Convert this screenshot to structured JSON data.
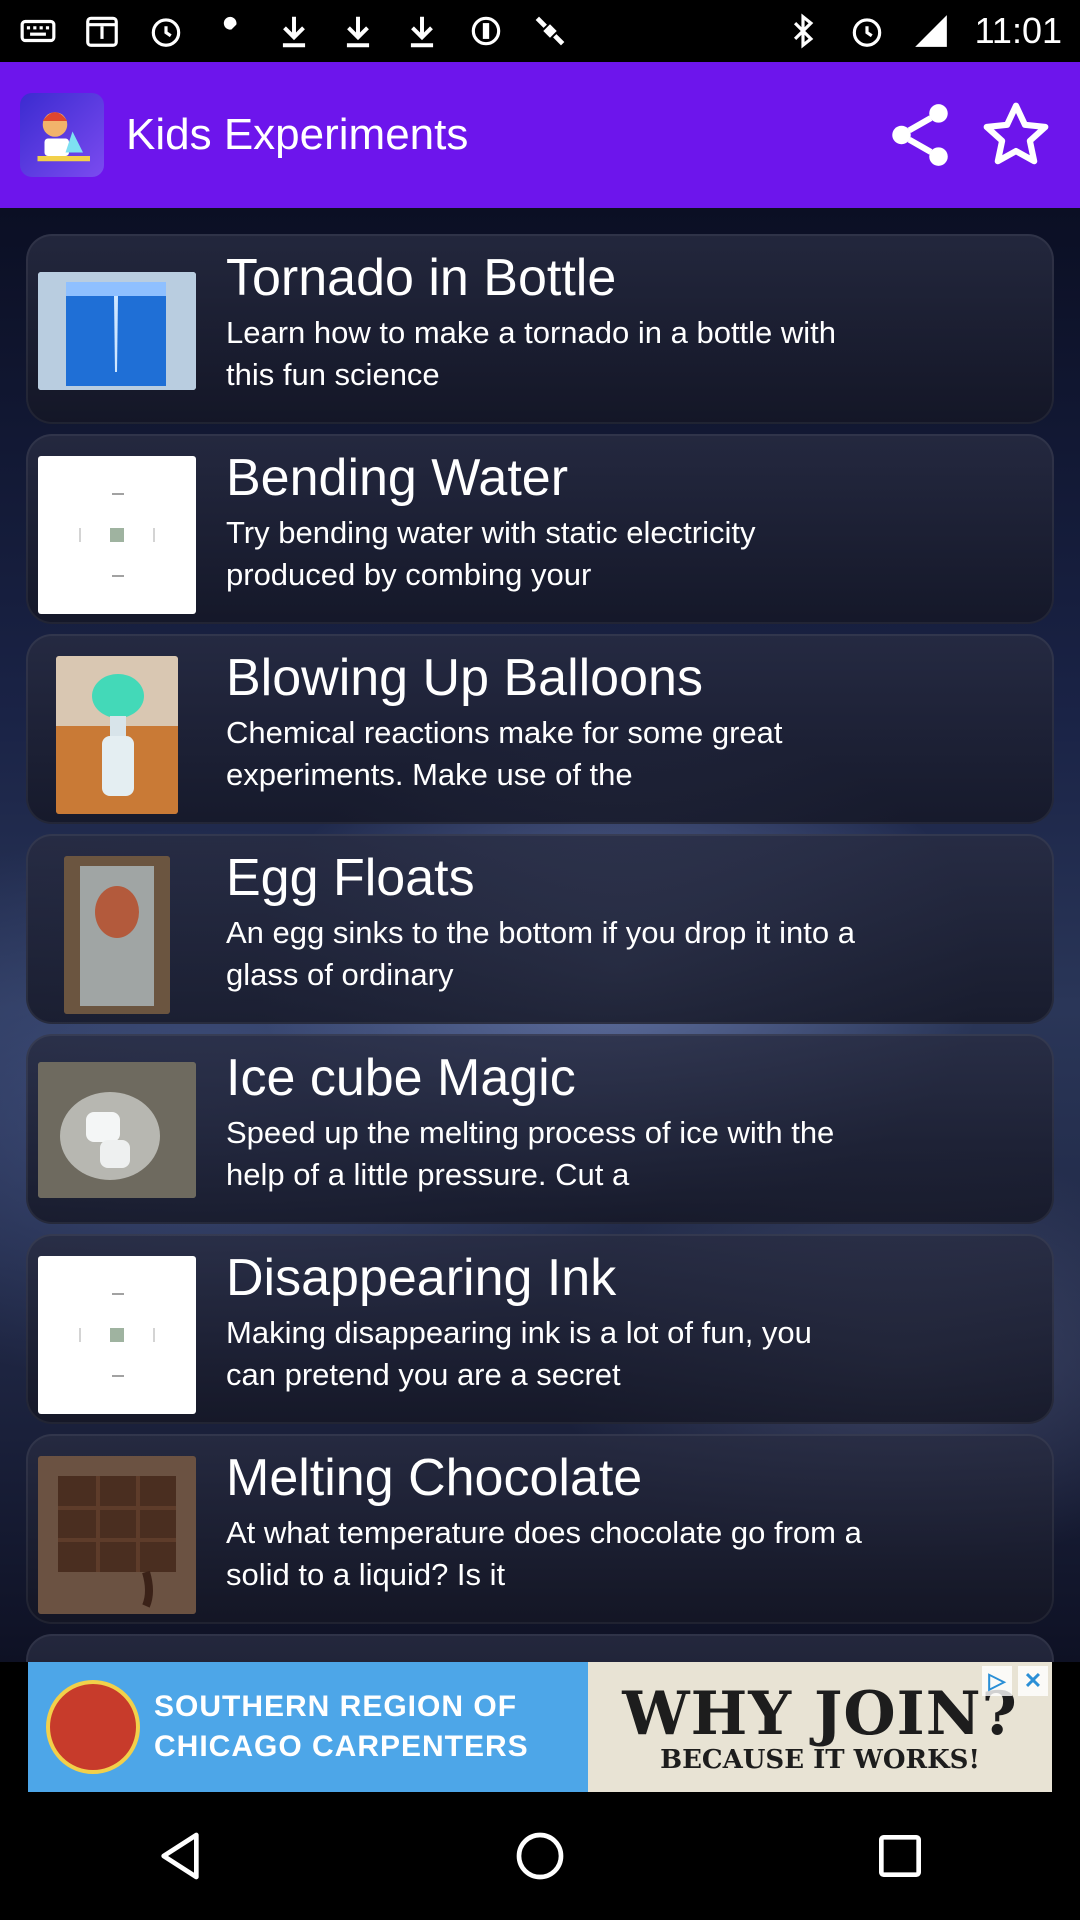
{
  "status_bar": {
    "time": "11:01",
    "left_icons": [
      "keyboard-icon",
      "calendar-icon",
      "alarm-icon",
      "wrench-icon",
      "download-icon",
      "download-icon",
      "download-icon",
      "gps-off-icon",
      "satellite-icon"
    ],
    "right_icons": [
      "bluetooth-icon",
      "alarm-icon",
      "signal-icon"
    ]
  },
  "app_bar": {
    "title": "Kids Experiments",
    "accent_color": "#6d15ec",
    "actions": [
      "share-icon",
      "star-icon"
    ]
  },
  "experiments": [
    {
      "title": "Tornado in Bottle",
      "description": "Learn how to make a tornado in a bottle with this fun science",
      "thumb": "tornado-bottle-photo"
    },
    {
      "title": "Bending Water",
      "description": "Try bending water with static electricity produced by combing your",
      "thumb": "broken-image-icon"
    },
    {
      "title": "Blowing Up Balloons",
      "description": "Chemical reactions make for some great experiments. Make use of the",
      "thumb": "balloon-bottle-photo"
    },
    {
      "title": "Egg Floats",
      "description": "An egg sinks to the bottom if you drop it into a glass of ordinary",
      "thumb": "egg-glass-photo"
    },
    {
      "title": "Ice cube Magic",
      "description": "Speed up the melting process of ice with the help of a little pressure. Cut a",
      "thumb": "ice-cube-photo"
    },
    {
      "title": "Disappearing Ink",
      "description": "Making disappearing ink is a lot of fun, you can pretend you are a secret",
      "thumb": "broken-image-icon"
    },
    {
      "title": "Melting Chocolate",
      "description": "At what temperature does chocolate go from a solid to a liquid? Is it",
      "thumb": "chocolate-photo"
    }
  ],
  "ad": {
    "left_line1": "SOUTHERN REGION OF",
    "left_line2": "CHICAGO CARPENTERS",
    "headline": "WHY JOIN?",
    "subline": "BECAUSE IT WORKS!"
  },
  "nav_bar": [
    "back-icon",
    "home-icon",
    "recents-icon"
  ]
}
